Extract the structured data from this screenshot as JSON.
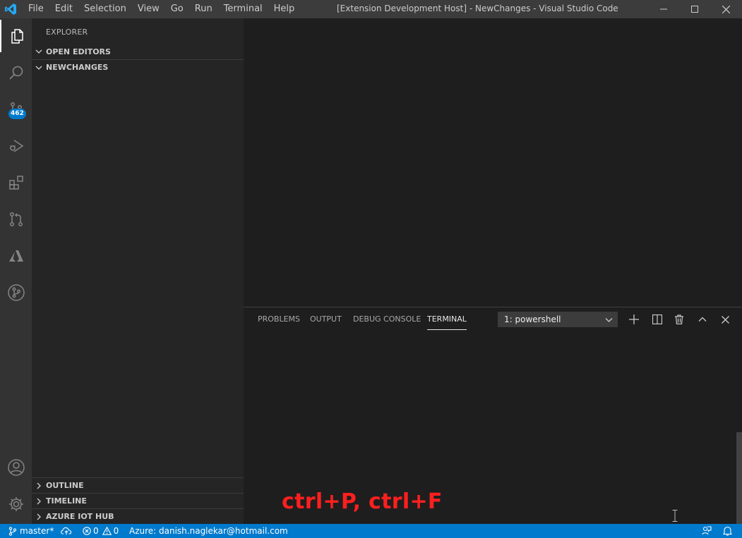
{
  "titlebar": {
    "logo_icon": "vscode-logo-icon",
    "menu": [
      "File",
      "Edit",
      "Selection",
      "View",
      "Go",
      "Run",
      "Terminal",
      "Help"
    ],
    "title": "[Extension Development Host] - NewChanges - Visual Studio Code"
  },
  "activitybar": {
    "items": [
      {
        "icon": "explorer-icon",
        "active": true
      },
      {
        "icon": "search-icon"
      },
      {
        "icon": "source-control-icon",
        "badge": "462"
      },
      {
        "icon": "run-debug-icon"
      },
      {
        "icon": "extensions-icon"
      },
      {
        "icon": "pull-request-icon"
      },
      {
        "icon": "azure-icon"
      },
      {
        "icon": "git-graph-icon"
      }
    ],
    "bottom": [
      {
        "icon": "account-icon"
      },
      {
        "icon": "manage-gear-icon"
      }
    ]
  },
  "sidebar": {
    "title": "EXPLORER",
    "sections_top": [
      "OPEN EDITORS",
      "NEWCHANGES"
    ],
    "sections_bottom": [
      "OUTLINE",
      "TIMELINE",
      "AZURE IOT HUB"
    ]
  },
  "panel": {
    "tabs": [
      "PROBLEMS",
      "OUTPUT",
      "DEBUG CONSOLE",
      "TERMINAL"
    ],
    "active_tab": "TERMINAL",
    "terminal_select": "1: powershell",
    "overlay_text": "ctrl+P, ctrl+F"
  },
  "statusbar": {
    "branch": "master*",
    "errors": "0",
    "warnings": "0",
    "account": "Azure: danish.naglekar@hotmail.com"
  },
  "colors": {
    "accent": "#007acc",
    "titlebar": "#3c3c3c",
    "activitybar": "#333333",
    "sidebar": "#252526",
    "editor": "#1e1e1e",
    "overlay": "#ff1f1f"
  }
}
